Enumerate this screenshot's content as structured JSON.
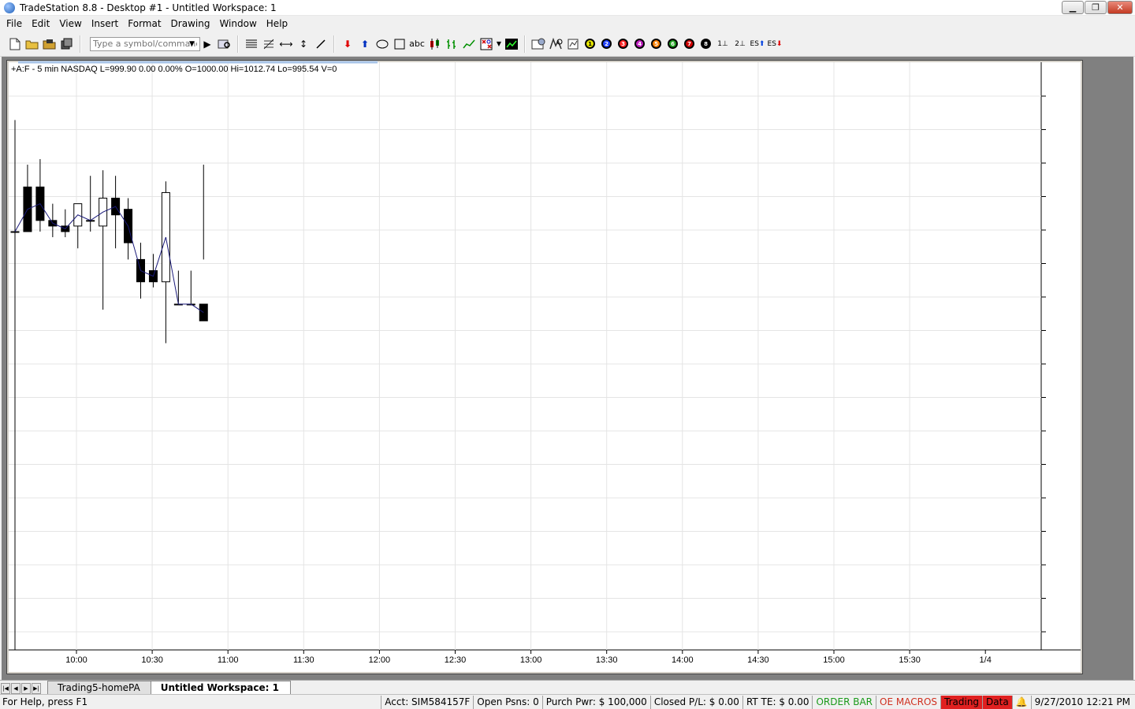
{
  "window": {
    "title": "TradeStation 8.8 - Desktop #1 - Untitled Workspace:  1",
    "minimize": "▁",
    "restore": "❐",
    "close": "✕"
  },
  "menu": [
    "File",
    "Edit",
    "View",
    "Insert",
    "Format",
    "Drawing",
    "Window",
    "Help"
  ],
  "toolbar": {
    "symbol_placeholder": "Type a symbol/command",
    "text_tool": "abc",
    "circle_labels": [
      "1",
      "2",
      "3",
      "4",
      "5",
      "6",
      "7",
      "8"
    ],
    "circle_colors": [
      "#e8e800",
      "#2040ff",
      "#ff2020",
      "#c020c0",
      "#ff8000",
      "#20a020",
      "#d00000",
      "#000000"
    ],
    "marker_1": "1",
    "marker_2": "2",
    "es_buy": "ES",
    "es_sell": "ES"
  },
  "chart_data": {
    "type": "candlestick",
    "header": "+A:F - 5 min  NASDAQ  L=999.90  0.00  0.00%  O=1000.00  Hi=1012.74  Lo=995.54  V=0",
    "x_ticks": [
      "10:00",
      "10:30",
      "11:00",
      "11:30",
      "12:00",
      "12:30",
      "13:00",
      "13:30",
      "14:00",
      "14:30",
      "15:00",
      "15:30",
      "1/4"
    ],
    "y_range": [
      0,
      1
    ],
    "grid": true,
    "candles": [
      {
        "t": "09:35",
        "o": 0.25,
        "h": 0.05,
        "l": 1.0,
        "c": 0.25
      },
      {
        "t": "09:40",
        "o": 0.17,
        "h": 0.13,
        "l": 0.25,
        "c": 0.25
      },
      {
        "t": "09:45",
        "o": 0.17,
        "h": 0.12,
        "l": 0.25,
        "c": 0.23
      },
      {
        "t": "09:50",
        "o": 0.23,
        "h": 0.2,
        "l": 0.26,
        "c": 0.24
      },
      {
        "t": "09:55",
        "o": 0.24,
        "h": 0.21,
        "l": 0.26,
        "c": 0.25
      },
      {
        "t": "10:00",
        "o": 0.24,
        "h": 0.2,
        "l": 0.28,
        "c": 0.2
      },
      {
        "t": "10:05",
        "o": 0.23,
        "h": 0.15,
        "l": 0.25,
        "c": 0.23
      },
      {
        "t": "10:10",
        "o": 0.24,
        "h": 0.14,
        "l": 0.39,
        "c": 0.19
      },
      {
        "t": "10:15",
        "o": 0.19,
        "h": 0.15,
        "l": 0.28,
        "c": 0.22
      },
      {
        "t": "10:20",
        "o": 0.21,
        "h": 0.19,
        "l": 0.3,
        "c": 0.27
      },
      {
        "t": "10:25",
        "o": 0.3,
        "h": 0.27,
        "l": 0.37,
        "c": 0.34
      },
      {
        "t": "10:30",
        "o": 0.32,
        "h": 0.29,
        "l": 0.35,
        "c": 0.34
      },
      {
        "t": "10:35",
        "o": 0.34,
        "h": 0.16,
        "l": 0.45,
        "c": 0.18
      },
      {
        "t": "10:40",
        "o": 0.38,
        "h": 0.32,
        "l": 0.38,
        "c": 0.38
      },
      {
        "t": "10:45",
        "o": 0.38,
        "h": 0.32,
        "l": 0.38,
        "c": 0.38
      },
      {
        "t": "10:50",
        "o": 0.38,
        "h": 0.13,
        "l": 0.3,
        "c": 0.41
      }
    ],
    "moving_average": {
      "color": "#1a1a7a"
    }
  },
  "tabs": [
    "Trading5-homePA",
    "Untitled Workspace:  1"
  ],
  "tab_nav": [
    "|◀",
    "◀",
    "▶",
    "▶|"
  ],
  "status": {
    "help": "For Help, press F1",
    "acct": "Acct: SIM584157F",
    "open_psns": "Open Psns: 0",
    "purch_pwr": "Purch Pwr: $ 100,000",
    "closed_pl": "Closed P/L: $ 0.00",
    "rt_te": "RT TE: $ 0.00",
    "order_bar": "ORDER BAR",
    "oe_macros": "OE MACROS",
    "trading": "Trading",
    "data": "Data",
    "datetime": "9/27/2010 12:21 PM"
  }
}
